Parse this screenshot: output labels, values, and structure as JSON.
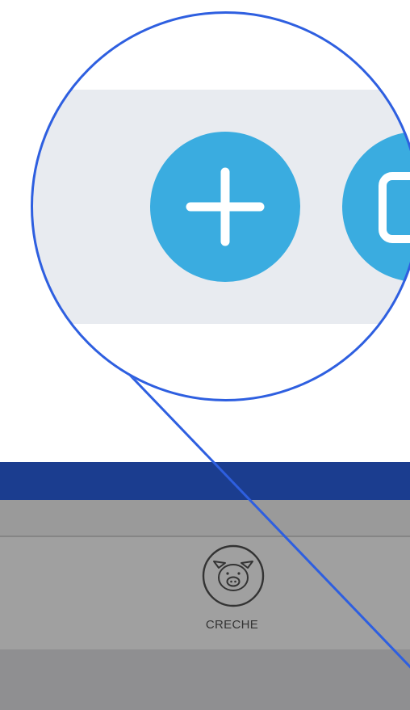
{
  "screen": {
    "header_color": "#1b3d8f",
    "panel_color": "#a0a0a0",
    "footer_color": "#8f8f91",
    "category": {
      "label": "CRECHE",
      "icon": "pig-icon"
    }
  },
  "magnifier": {
    "ring_color": "#2e5fe0",
    "background_color": "#e8ebf0",
    "buttons": [
      {
        "icon": "plus-icon",
        "color": "#3aace0"
      },
      {
        "icon": "edit-icon",
        "color": "#3aace0"
      }
    ]
  }
}
